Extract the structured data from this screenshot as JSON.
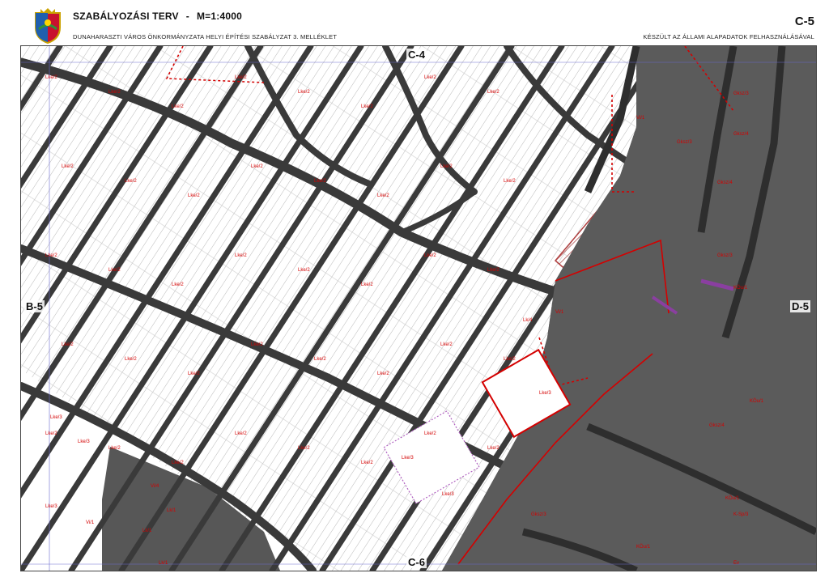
{
  "header": {
    "title": "SZABÁLYOZÁSI TERV",
    "title_separator": "-",
    "scale": "M=1:4000",
    "subtitle": "DUNAHARASZTI VÁROS ÖNKORMÁNYZATA HELYI ÉPÍTÉSI SZABÁLYZAT 3. MELLÉKLET",
    "sheet_code": "C-5",
    "source_note": "KÉSZÜLT AZ ÁLLAMI ALAPADATOK FELHASZNÁLÁSÁVAL"
  },
  "adjacent_sheets": {
    "north": "C-4",
    "south": "C-6",
    "west": "B-5",
    "east": "D-5"
  },
  "zone_labels": [
    "Lke/2",
    "Lke/2",
    "Lke/2",
    "Lke/2",
    "Lke/2",
    "Lke/2",
    "Lke/2",
    "Lke/2",
    "Lke/2",
    "Lke/2",
    "Lke/2",
    "Lke/2",
    "Lke/2",
    "Lke/2",
    "Lke/2",
    "Lke/2",
    "Lke/2",
    "Lke/2",
    "Lke/2",
    "Lke/2",
    "Lke/2",
    "Lke/2",
    "Lke/2",
    "Lke/2",
    "Lke/2",
    "Lke/2",
    "Lke/2",
    "Lke/2",
    "Lke/2",
    "Lke/2",
    "Lke/2",
    "Lke/2",
    "Lke/2",
    "Lke/2",
    "Lke/2",
    "Lke/2",
    "Lke/2",
    "Lke/2",
    "Lke/2",
    "Lke/2",
    "Lke/3",
    "Lke/3",
    "Lke/3",
    "Lke/3",
    "Lke/3",
    "Lke/3",
    "Lk/1",
    "Lk/1",
    "Lk/1",
    "Lk/4",
    "Vi/1",
    "Vi/1",
    "Vi/1",
    "Vi/4",
    "Gksz/3",
    "Gksz/3",
    "Gksz/3",
    "Gksz/4",
    "Gksz/4",
    "Gksz/4",
    "Gksz/3",
    "KÖu/1",
    "KÖu/1",
    "KÖu/1",
    "KÖu/1",
    "K-Sp/3",
    "Ev"
  ],
  "colors": {
    "parcel_fill": "#ffffff",
    "parcel_line": "#9a9a9a",
    "road": "#3a3a3a",
    "industrial_zone": "#5a5a5a",
    "regulation_red": "#d40000",
    "railway_purple": "#8a3fa0",
    "hatch": "#b05050",
    "green_edge": "#5a9a3a"
  }
}
